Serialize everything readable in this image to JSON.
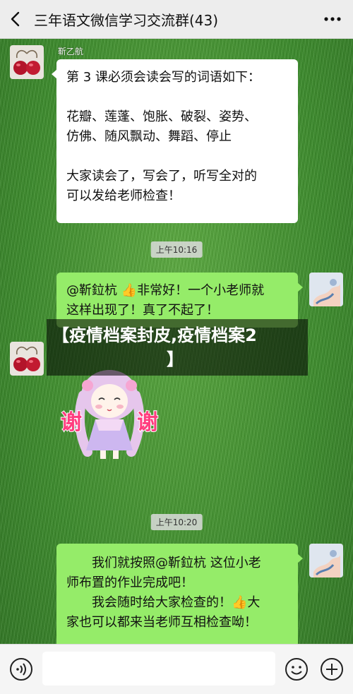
{
  "header": {
    "title": "三年语文微信学习交流群(43)",
    "back_icon": "chevron-left-icon",
    "more_icon": "more-dots-icon"
  },
  "messages": {
    "m1": {
      "sender": "靳乙航",
      "lines": [
        "第 3 课必须会读会写的词语如下：",
        "",
        "花瓣、莲蓬、饱胀、破裂、姿势、",
        "仿佛、随风飘动、舞蹈、停止",
        "",
        "大家读会了，写会了，听写全对的",
        "可以发给老师检查！"
      ]
    },
    "time1": "上午10:16",
    "m2": {
      "line1_prefix": "@靳鉝杭 ",
      "thumb": "👍",
      "line1_suffix": "非常好！一个小老师就",
      "line2": "这样出现了！真了不起了！"
    },
    "m3": {
      "sticker_text_left": "谢",
      "sticker_text_right": "谢"
    },
    "time2": "上午10:20",
    "m4": {
      "line1": "我们就按照@靳鉝杭  这位小老",
      "line2": "师布置的作业完成吧！",
      "line3_prefix": "我会随时给大家检查的！",
      "thumb": "👍",
      "line3_suffix": "大",
      "line4": "家也可以都来当老师互相检查呦！"
    }
  },
  "overlay": {
    "line1": "【疫情档案封皮,疫情档案2",
    "line2": "】"
  },
  "input_bar": {
    "voice_icon": "voice-icon",
    "emoji_icon": "emoji-icon",
    "add_icon": "plus-circle-icon"
  },
  "colors": {
    "header_bg": "#ededed",
    "bubble_sent": "#95ec69",
    "bubble_received": "#ffffff",
    "chat_bg": "#3f8f2e"
  }
}
